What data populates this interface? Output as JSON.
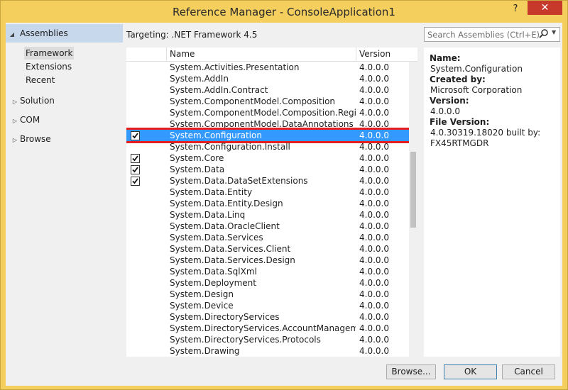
{
  "window": {
    "title": "Reference Manager - ConsoleApplication1",
    "help": "?",
    "close": "✕"
  },
  "sidebar": {
    "header": "Assemblies",
    "sub_items": [
      "Framework",
      "Extensions",
      "Recent"
    ],
    "items": [
      "Solution",
      "COM",
      "Browse"
    ]
  },
  "targeting": "Targeting: .NET Framework 4.5",
  "search": {
    "placeholder": "Search Assemblies (Ctrl+E)",
    "icon": "search-icon"
  },
  "list": {
    "columns": [
      "Name",
      "Version"
    ],
    "rows": [
      {
        "name": "System.Activities.Presentation",
        "version": "4.0.0.0",
        "checked": false
      },
      {
        "name": "System.AddIn",
        "version": "4.0.0.0",
        "checked": false
      },
      {
        "name": "System.AddIn.Contract",
        "version": "4.0.0.0",
        "checked": false
      },
      {
        "name": "System.ComponentModel.Composition",
        "version": "4.0.0.0",
        "checked": false
      },
      {
        "name": "System.ComponentModel.Composition.Regist...",
        "version": "4.0.0.0",
        "checked": false
      },
      {
        "name": "System.ComponentModel.DataAnnotations",
        "version": "4.0.0.0",
        "checked": false
      },
      {
        "name": "System.Configuration",
        "version": "4.0.0.0",
        "checked": true,
        "selected": true
      },
      {
        "name": "System.Configuration.Install",
        "version": "4.0.0.0",
        "checked": false
      },
      {
        "name": "System.Core",
        "version": "4.0.0.0",
        "checked": true
      },
      {
        "name": "System.Data",
        "version": "4.0.0.0",
        "checked": true
      },
      {
        "name": "System.Data.DataSetExtensions",
        "version": "4.0.0.0",
        "checked": true
      },
      {
        "name": "System.Data.Entity",
        "version": "4.0.0.0",
        "checked": false
      },
      {
        "name": "System.Data.Entity.Design",
        "version": "4.0.0.0",
        "checked": false
      },
      {
        "name": "System.Data.Linq",
        "version": "4.0.0.0",
        "checked": false
      },
      {
        "name": "System.Data.OracleClient",
        "version": "4.0.0.0",
        "checked": false
      },
      {
        "name": "System.Data.Services",
        "version": "4.0.0.0",
        "checked": false
      },
      {
        "name": "System.Data.Services.Client",
        "version": "4.0.0.0",
        "checked": false
      },
      {
        "name": "System.Data.Services.Design",
        "version": "4.0.0.0",
        "checked": false
      },
      {
        "name": "System.Data.SqlXml",
        "version": "4.0.0.0",
        "checked": false
      },
      {
        "name": "System.Deployment",
        "version": "4.0.0.0",
        "checked": false
      },
      {
        "name": "System.Design",
        "version": "4.0.0.0",
        "checked": false
      },
      {
        "name": "System.Device",
        "version": "4.0.0.0",
        "checked": false
      },
      {
        "name": "System.DirectoryServices",
        "version": "4.0.0.0",
        "checked": false
      },
      {
        "name": "System.DirectoryServices.AccountManagement",
        "version": "4.0.0.0",
        "checked": false
      },
      {
        "name": "System.DirectoryServices.Protocols",
        "version": "4.0.0.0",
        "checked": false
      },
      {
        "name": "System.Drawing",
        "version": "4.0.0.0",
        "checked": false
      }
    ]
  },
  "details": {
    "name_label": "Name:",
    "name_value": "System.Configuration",
    "created_label": "Created by:",
    "created_value": "Microsoft Corporation",
    "version_label": "Version:",
    "version_value": "4.0.0.0",
    "file_label": "File Version:",
    "file_value_1": "4.0.30319.18020 built by:",
    "file_value_2": "FX45RTMGDR"
  },
  "buttons": {
    "browse": "Browse...",
    "ok": "OK",
    "cancel": "Cancel"
  },
  "colors": {
    "titlebar": "#f4cf5e",
    "selection": "#3399ff",
    "highlight_box": "#e51f1f",
    "close": "#c7392b"
  }
}
